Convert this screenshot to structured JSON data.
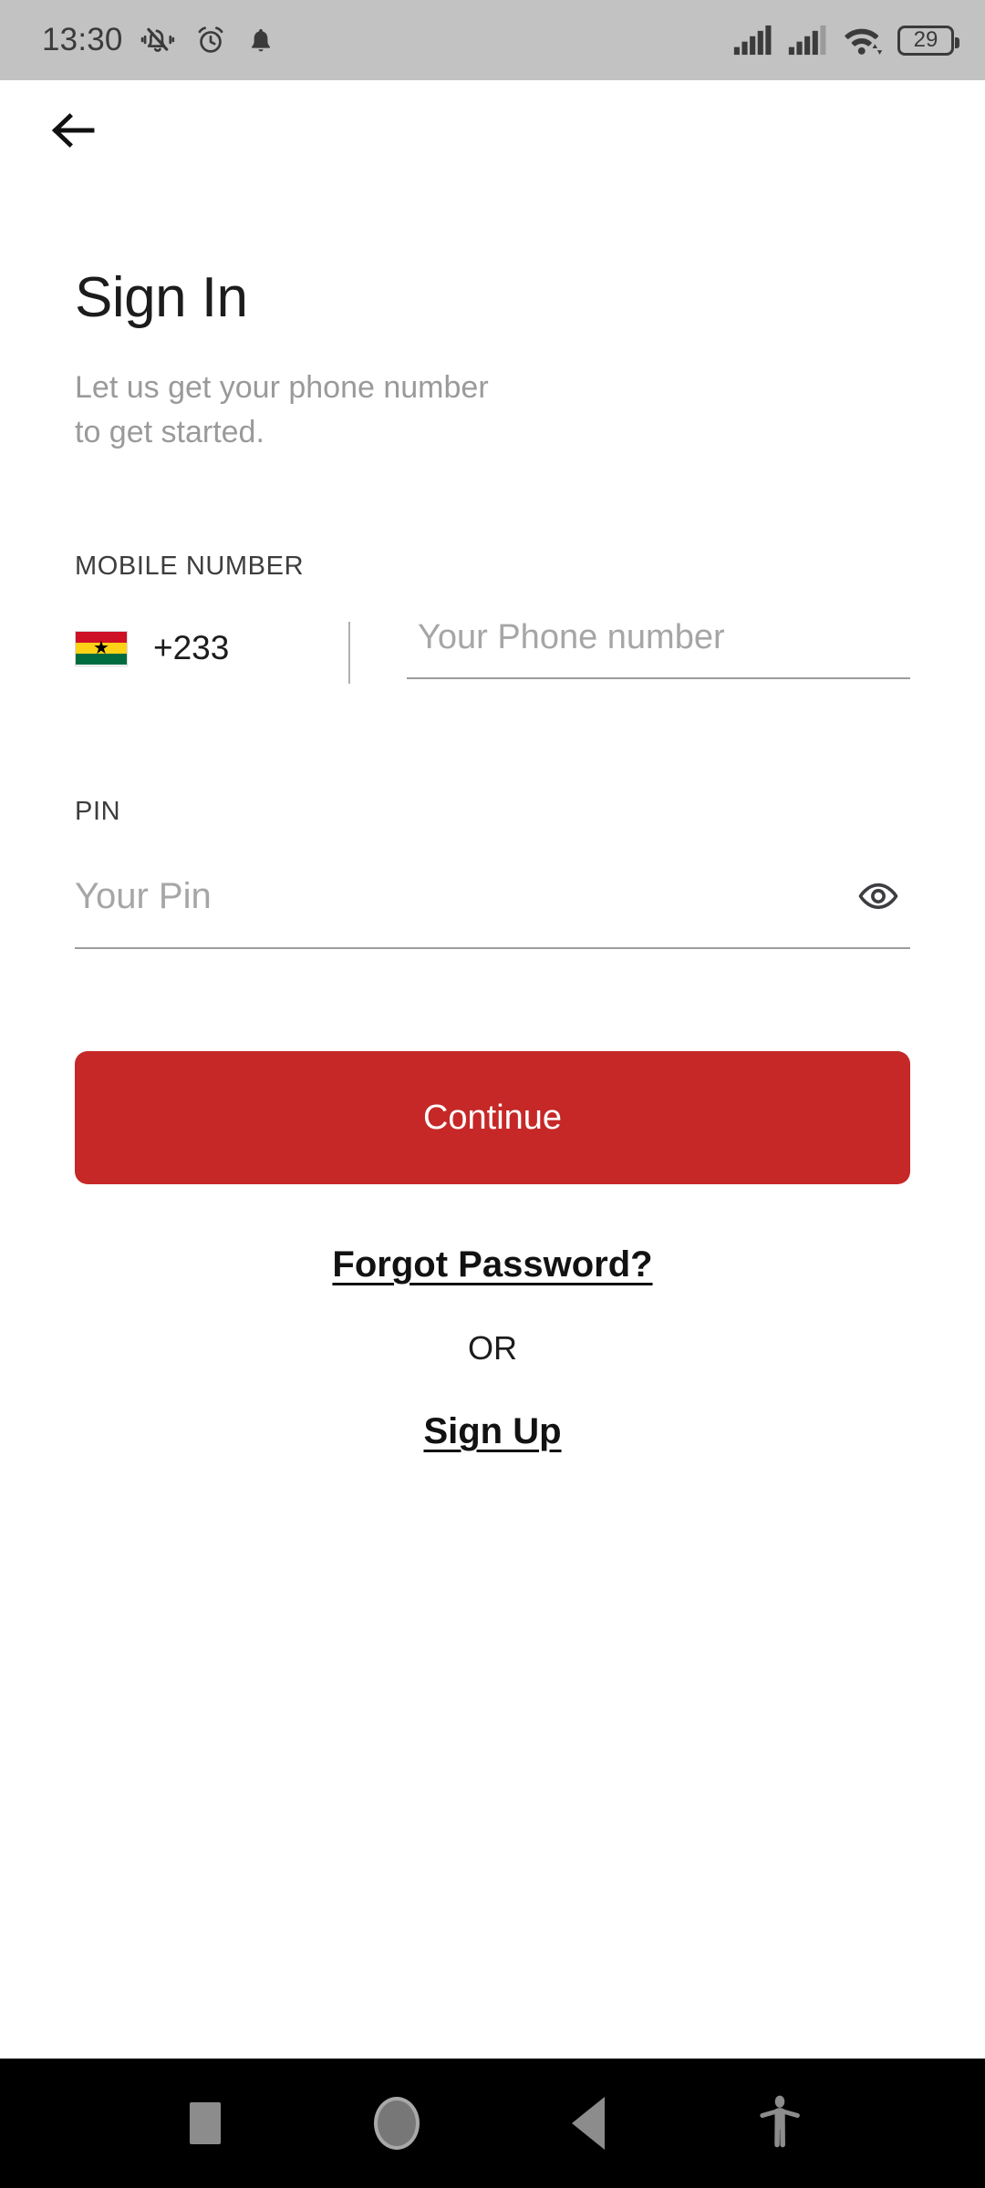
{
  "status_bar": {
    "time": "13:30",
    "battery_level": "29",
    "icons": {
      "silent": "bell-muted-vibrate-icon",
      "alarm": "alarm-clock-icon",
      "notification": "bell-icon",
      "signal_one": "signal-bars-sim1-icon",
      "signal_two": "signal-bars-sim2-icon",
      "wifi": "wifi-icon",
      "battery": "battery-icon"
    }
  },
  "app_bar": {
    "back_icon": "arrow-left-icon"
  },
  "main": {
    "title": "Sign In",
    "subtitle": "Let us get your phone number\nto get started.",
    "mobile_number": {
      "label": "MOBILE NUMBER",
      "flag": "ghana-flag-icon",
      "dial_code": "+233",
      "placeholder": "Your Phone number",
      "value": ""
    },
    "pin": {
      "label": "PIN",
      "placeholder": "Your Pin",
      "value": "",
      "toggle_icon": "eye-icon"
    },
    "continue_label": "Continue",
    "forgot_password_label": "Forgot Password?",
    "or_label": "OR",
    "sign_up_label": "Sign Up"
  },
  "nav_bar": {
    "recents": "square-icon",
    "home": "circle-icon",
    "back": "triangle-back-icon",
    "accessibility": "accessibility-person-icon"
  },
  "colors": {
    "primary_red": "#c62828",
    "status_bar_bg": "#c2c2c2",
    "nav_bar_bg": "#000000",
    "text_primary": "#1c1c1c",
    "text_muted": "#9a9a9a"
  }
}
